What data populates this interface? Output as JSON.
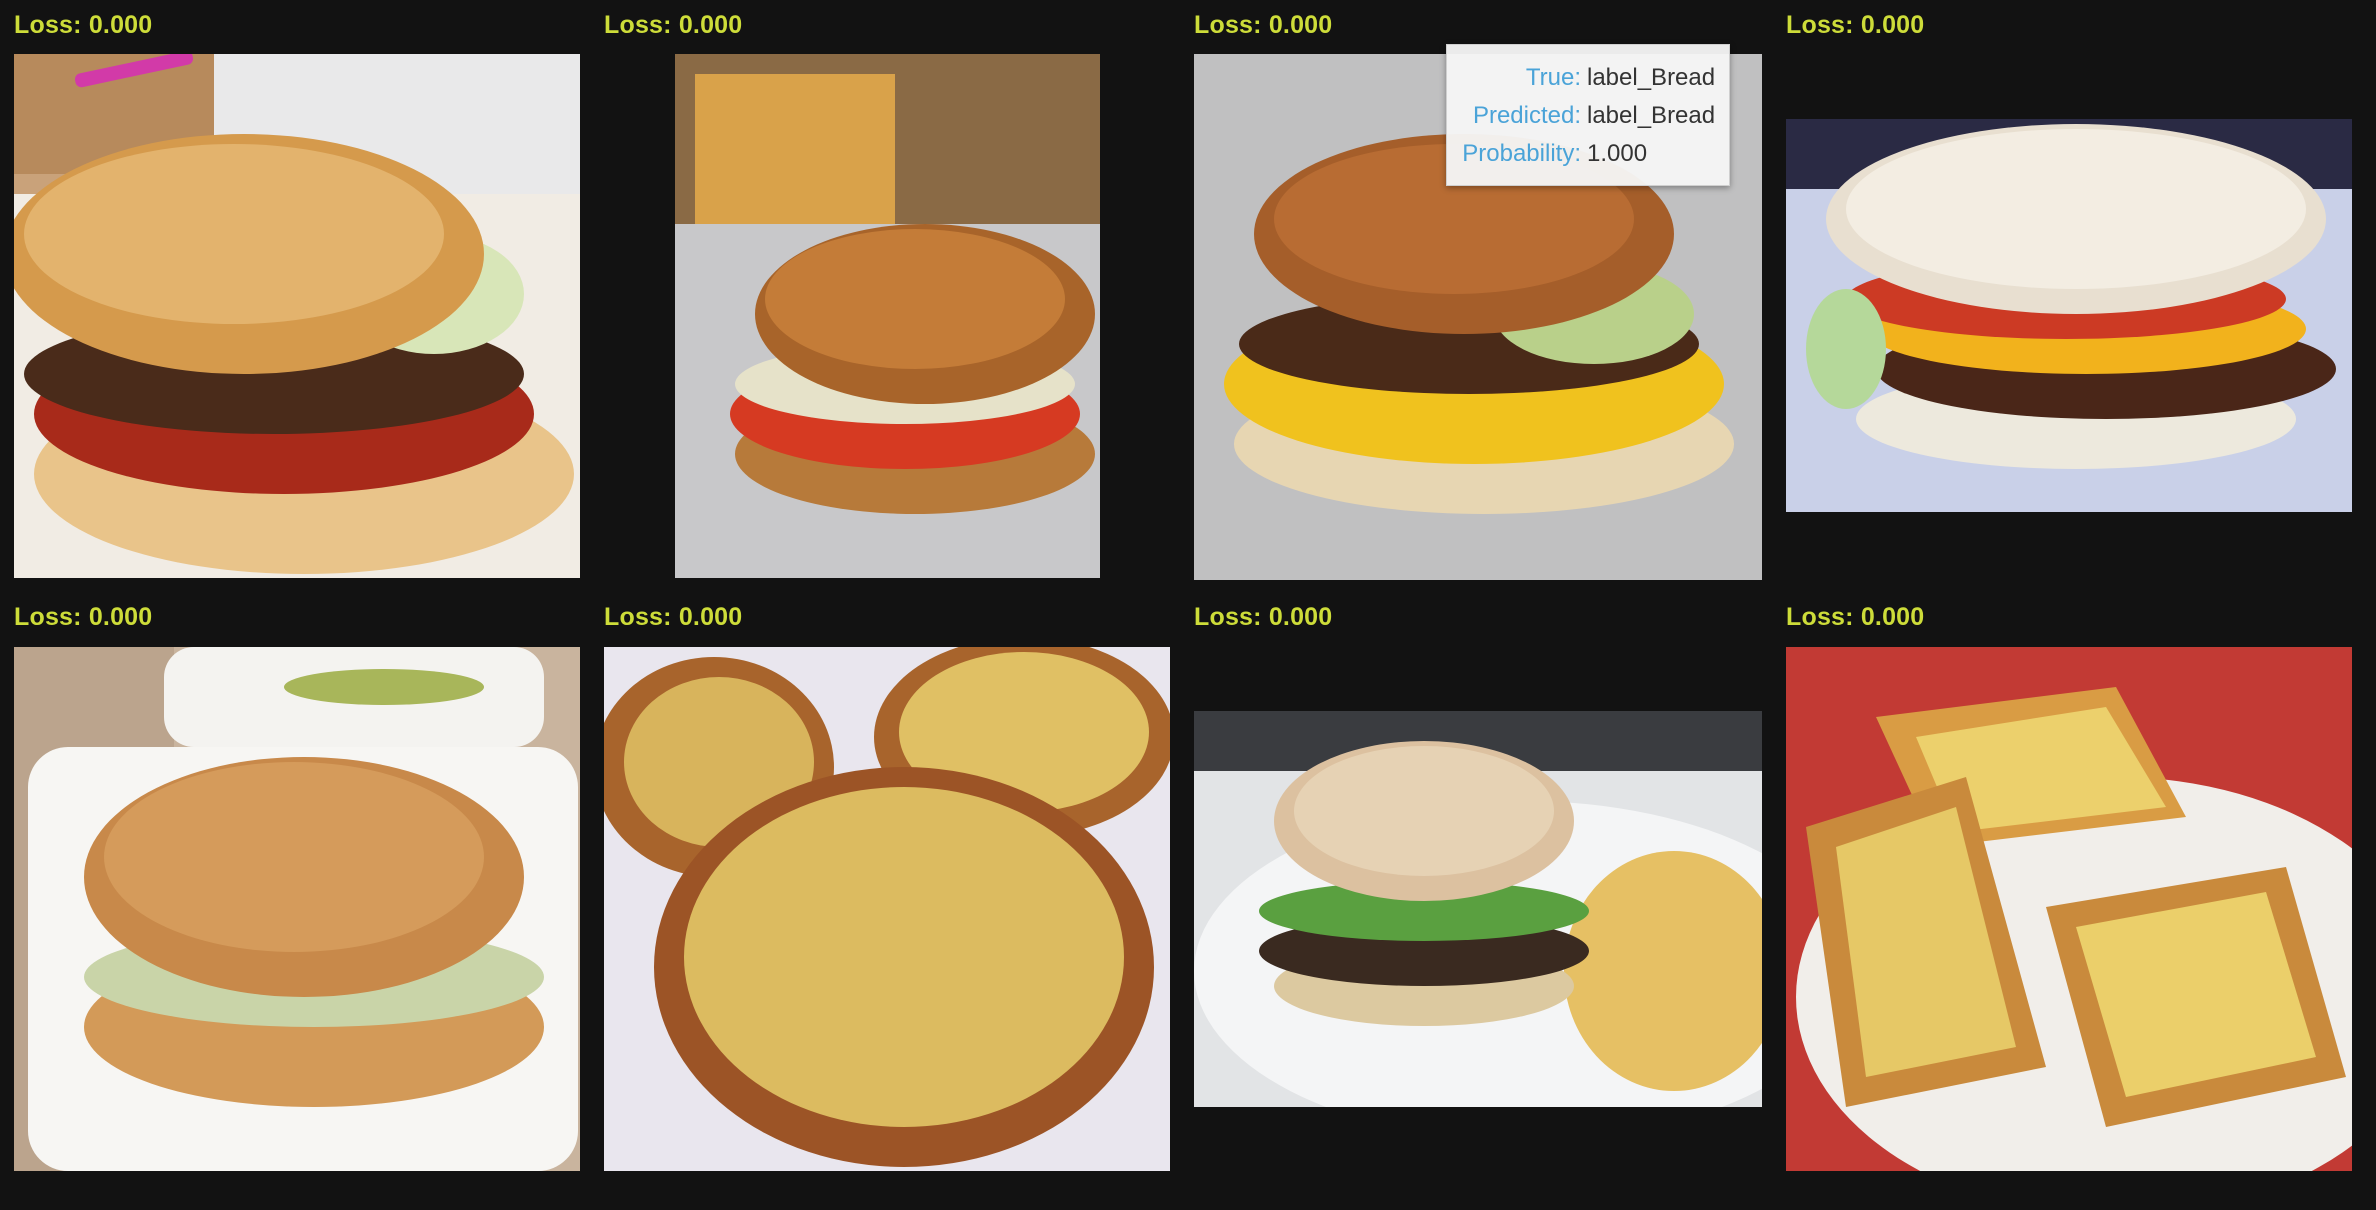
{
  "grid": [
    {
      "loss": "Loss: 0.000",
      "image": "burger-on-desk-photo"
    },
    {
      "loss": "Loss: 0.000",
      "image": "burger-with-fries-on-foil-photo"
    },
    {
      "loss": "Loss: 0.000",
      "image": "double-cheeseburger-on-foil-photo"
    },
    {
      "loss": "Loss: 0.000",
      "image": "bacon-cheeseburger-photo"
    },
    {
      "loss": "Loss: 0.000",
      "image": "burger-in-takeout-box-photo"
    },
    {
      "loss": "Loss: 0.000",
      "image": "garlic-bread-basket-photo"
    },
    {
      "loss": "Loss: 0.000",
      "image": "burger-and-fries-plate-photo"
    },
    {
      "loss": "Loss: 0.000",
      "image": "garlic-toast-plate-photo"
    }
  ],
  "tooltip": {
    "true_label": "True:",
    "true_value": "label_Bread",
    "predicted_label": "Predicted:",
    "predicted_value": "label_Bread",
    "probability_label": "Probability:",
    "probability_value": "1.000"
  },
  "colors": {
    "background": "#121212",
    "loss_text": "#cddc39",
    "tooltip_key": "#4aa3d8"
  }
}
